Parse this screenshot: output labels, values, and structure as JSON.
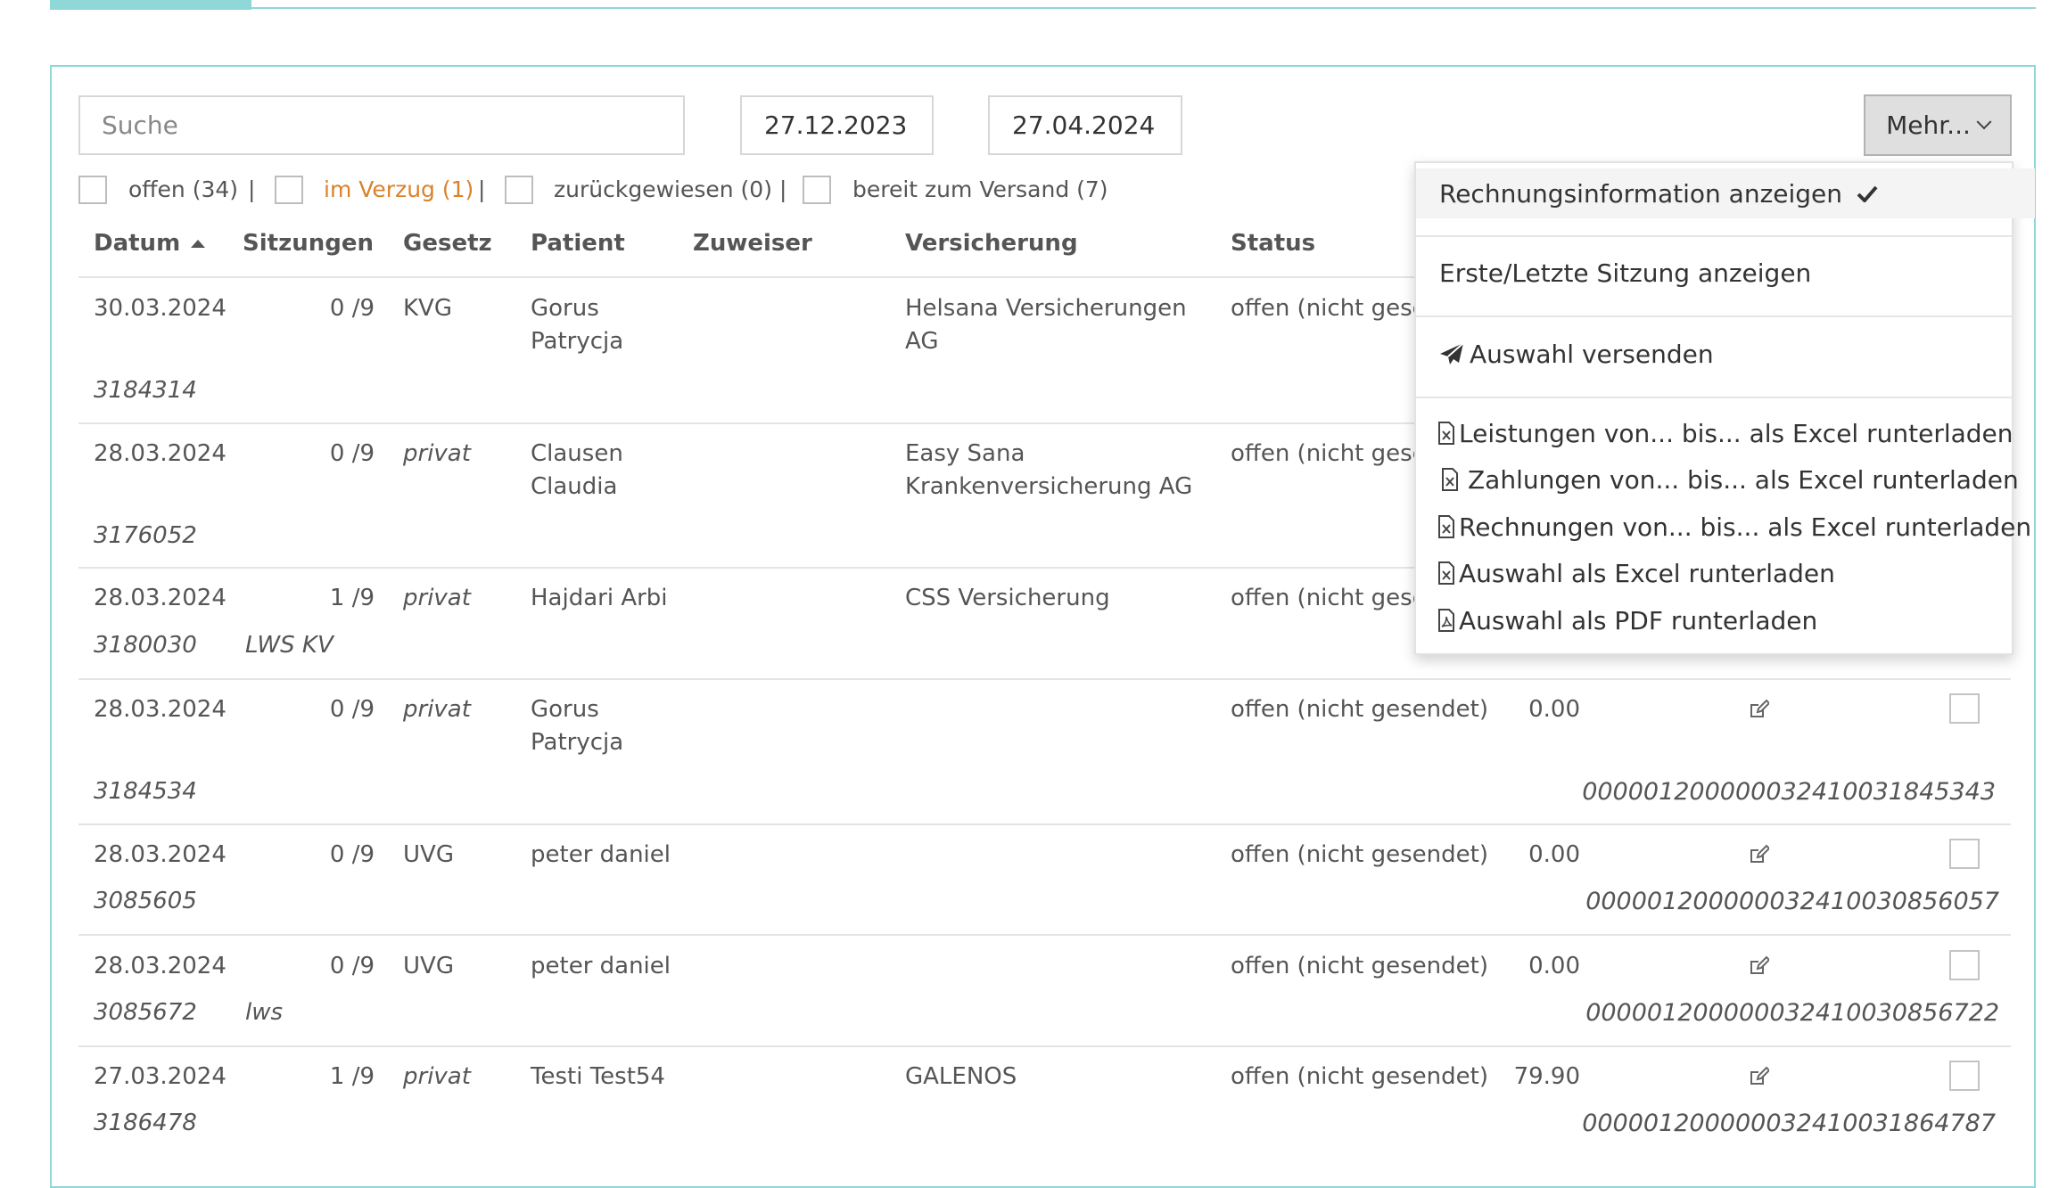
{
  "filter_bar": {
    "search_placeholder": "Suche",
    "date_from": "27.12.2023",
    "date_to": "27.04.2024",
    "more_button_label": "Mehr..."
  },
  "status_filters": [
    {
      "label": "offen (34)",
      "color": "#555555"
    },
    {
      "label": "im Verzug (1)",
      "color": "#d9822b"
    },
    {
      "label": "zurückgewiesen (0)",
      "color": "#555555"
    },
    {
      "label": "bereit zum Versand (7)",
      "color": "#555555"
    }
  ],
  "filter_separator": "|",
  "table": {
    "headers": {
      "datum": "Datum",
      "sitzungen": "Sitzungen",
      "gesetz": "Gesetz",
      "patient": "Patient",
      "zuweiser": "Zuweiser",
      "versicherung": "Versicherung",
      "status": "Status"
    },
    "rows": [
      {
        "date": "30.03.2024",
        "sessions": "0 /9",
        "law": "KVG",
        "law_italic": false,
        "patient_line1": "Gorus",
        "patient_line2": "Patrycja",
        "referrer": "",
        "insurance_line1": "Helsana Versicherungen",
        "insurance_line2": "AG",
        "status": "offen (nicht gese",
        "amount": "",
        "invoice_nr": "3184314",
        "note": "",
        "reference": ""
      },
      {
        "date": "28.03.2024",
        "sessions": "0 /9",
        "law": "privat",
        "law_italic": true,
        "patient_line1": "Clausen",
        "patient_line2": "Claudia",
        "referrer": "",
        "insurance_line1": "Easy Sana",
        "insurance_line2": "Krankenversicherung AG",
        "status": "offen (nicht gese",
        "amount": "",
        "invoice_nr": "3176052",
        "note": "",
        "reference": ""
      },
      {
        "date": "28.03.2024",
        "sessions": "1 /9",
        "law": "privat",
        "law_italic": true,
        "patient_line1": "Hajdari Arbi",
        "patient_line2": "",
        "referrer": "",
        "insurance_line1": "CSS Versicherung",
        "insurance_line2": "",
        "status": "offen (nicht gese",
        "amount": "",
        "invoice_nr": "3180030",
        "note": "LWS KV",
        "reference": ""
      },
      {
        "date": "28.03.2024",
        "sessions": "0 /9",
        "law": "privat",
        "law_italic": true,
        "patient_line1": "Gorus",
        "patient_line2": "Patrycja",
        "referrer": "",
        "insurance_line1": "",
        "insurance_line2": "",
        "status": "offen (nicht gesendet)",
        "amount": "0.00",
        "invoice_nr": "3184534",
        "note": "",
        "reference": "000001200000032410031845343"
      },
      {
        "date": "28.03.2024",
        "sessions": "0 /9",
        "law": "UVG",
        "law_italic": false,
        "patient_line1": "peter daniel",
        "patient_line2": "",
        "referrer": "",
        "insurance_line1": "",
        "insurance_line2": "",
        "status": "offen (nicht gesendet)",
        "amount": "0.00",
        "invoice_nr": "3085605",
        "note": "",
        "reference": "000001200000032410030856057"
      },
      {
        "date": "28.03.2024",
        "sessions": "0 /9",
        "law": "UVG",
        "law_italic": false,
        "patient_line1": "peter daniel",
        "patient_line2": "",
        "referrer": "",
        "insurance_line1": "",
        "insurance_line2": "",
        "status": "offen (nicht gesendet)",
        "amount": "0.00",
        "invoice_nr": "3085672",
        "note": "lws",
        "reference": "000001200000032410030856722"
      },
      {
        "date": "27.03.2024",
        "sessions": "1 /9",
        "law": "privat",
        "law_italic": true,
        "patient_line1": "Testi Test54",
        "patient_line2": "",
        "referrer": "",
        "insurance_line1": "GALENOS",
        "insurance_line2": "",
        "status": "offen (nicht gesendet)",
        "amount": "79.90",
        "invoice_nr": "3186478",
        "note": "",
        "reference": "000001200000032410031864787"
      }
    ]
  },
  "more_menu": {
    "show_invoice_info": "Rechnungsinformation anzeigen",
    "show_first_last_session": "Erste/Letzte Sitzung anzeigen",
    "send_selection": "Auswahl versenden",
    "download_services_excel": "Leistungen von... bis... als Excel runterladen",
    "download_payments_excel": "Zahlungen von... bis... als Excel runterladen",
    "download_invoices_excel": "Rechnungen von... bis... als Excel runterladen",
    "download_selection_excel": "Auswahl als Excel runterladen",
    "download_selection_pdf": "Auswahl als PDF runterladen",
    "icons": [
      "check-icon",
      "paper-plane-icon",
      "excel-file-icon",
      "pdf-file-icon",
      "edit-icon"
    ]
  },
  "colors": {
    "accent": "#8fd8d8",
    "warning": "#d9822b"
  }
}
